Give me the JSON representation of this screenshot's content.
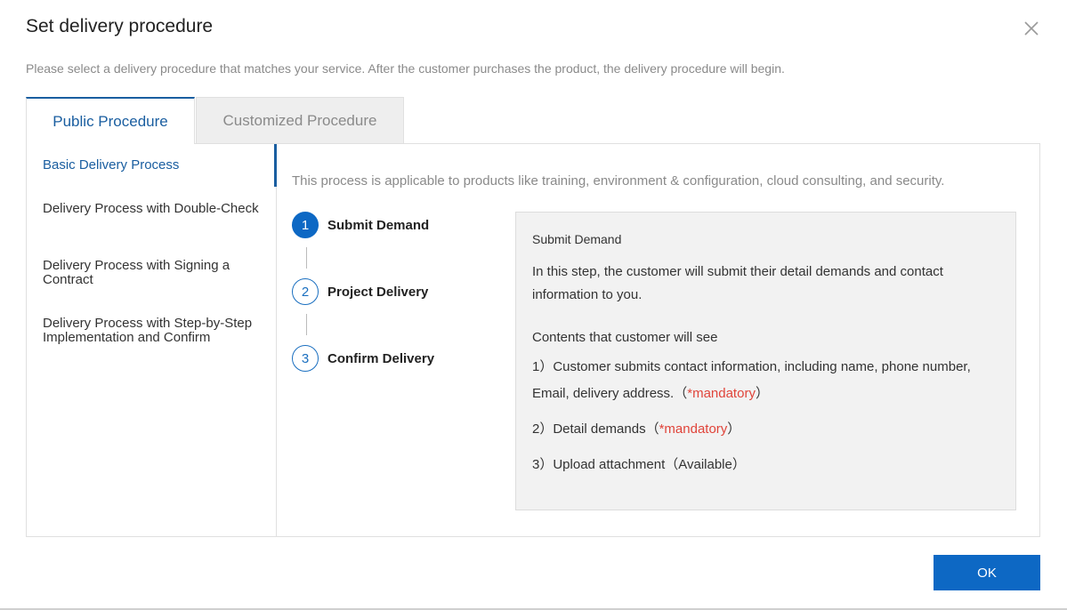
{
  "dialog": {
    "title": "Set delivery procedure",
    "subtitle": "Please select a delivery procedure that matches your service. After the customer purchases the product, the delivery procedure will begin."
  },
  "tabs": [
    {
      "label": "Public Procedure",
      "active": true
    },
    {
      "label": "Customized Procedure",
      "active": false
    }
  ],
  "sidebar": {
    "items": [
      {
        "label": "Basic Delivery Process",
        "active": true
      },
      {
        "label": "Delivery Process with Double-Check"
      },
      {
        "label": "Delivery Process with Signing a Contract"
      },
      {
        "label": "Delivery Process with Step-by-Step Implementation and Confirm"
      }
    ]
  },
  "main": {
    "description": "This process is applicable to products like training, environment & configuration, cloud consulting, and security.",
    "steps": [
      {
        "number": "1",
        "label": "Submit Demand",
        "active": true
      },
      {
        "number": "2",
        "label": "Project Delivery"
      },
      {
        "number": "3",
        "label": "Confirm Delivery"
      }
    ],
    "info": {
      "title": "Submit Demand",
      "text": "In this step, the customer will submit their detail demands and contact information to you.",
      "subheading": "Contents that customer will see",
      "items": [
        {
          "prefix": "1）Customer submits contact information, including name, phone number, Email, delivery address.（",
          "highlight": "*mandatory",
          "suffix": "）"
        },
        {
          "prefix": "2）Detail demands（",
          "highlight": "*mandatory",
          "suffix": "）"
        },
        {
          "prefix": "3）Upload attachment（Available）",
          "highlight": "",
          "suffix": ""
        }
      ]
    }
  },
  "footer": {
    "ok_label": "OK"
  },
  "colors": {
    "accent": "#0d68c4",
    "mandatory": "#e0443a",
    "muted": "#8a8a8a"
  },
  "icons": {
    "close": "close-icon"
  }
}
